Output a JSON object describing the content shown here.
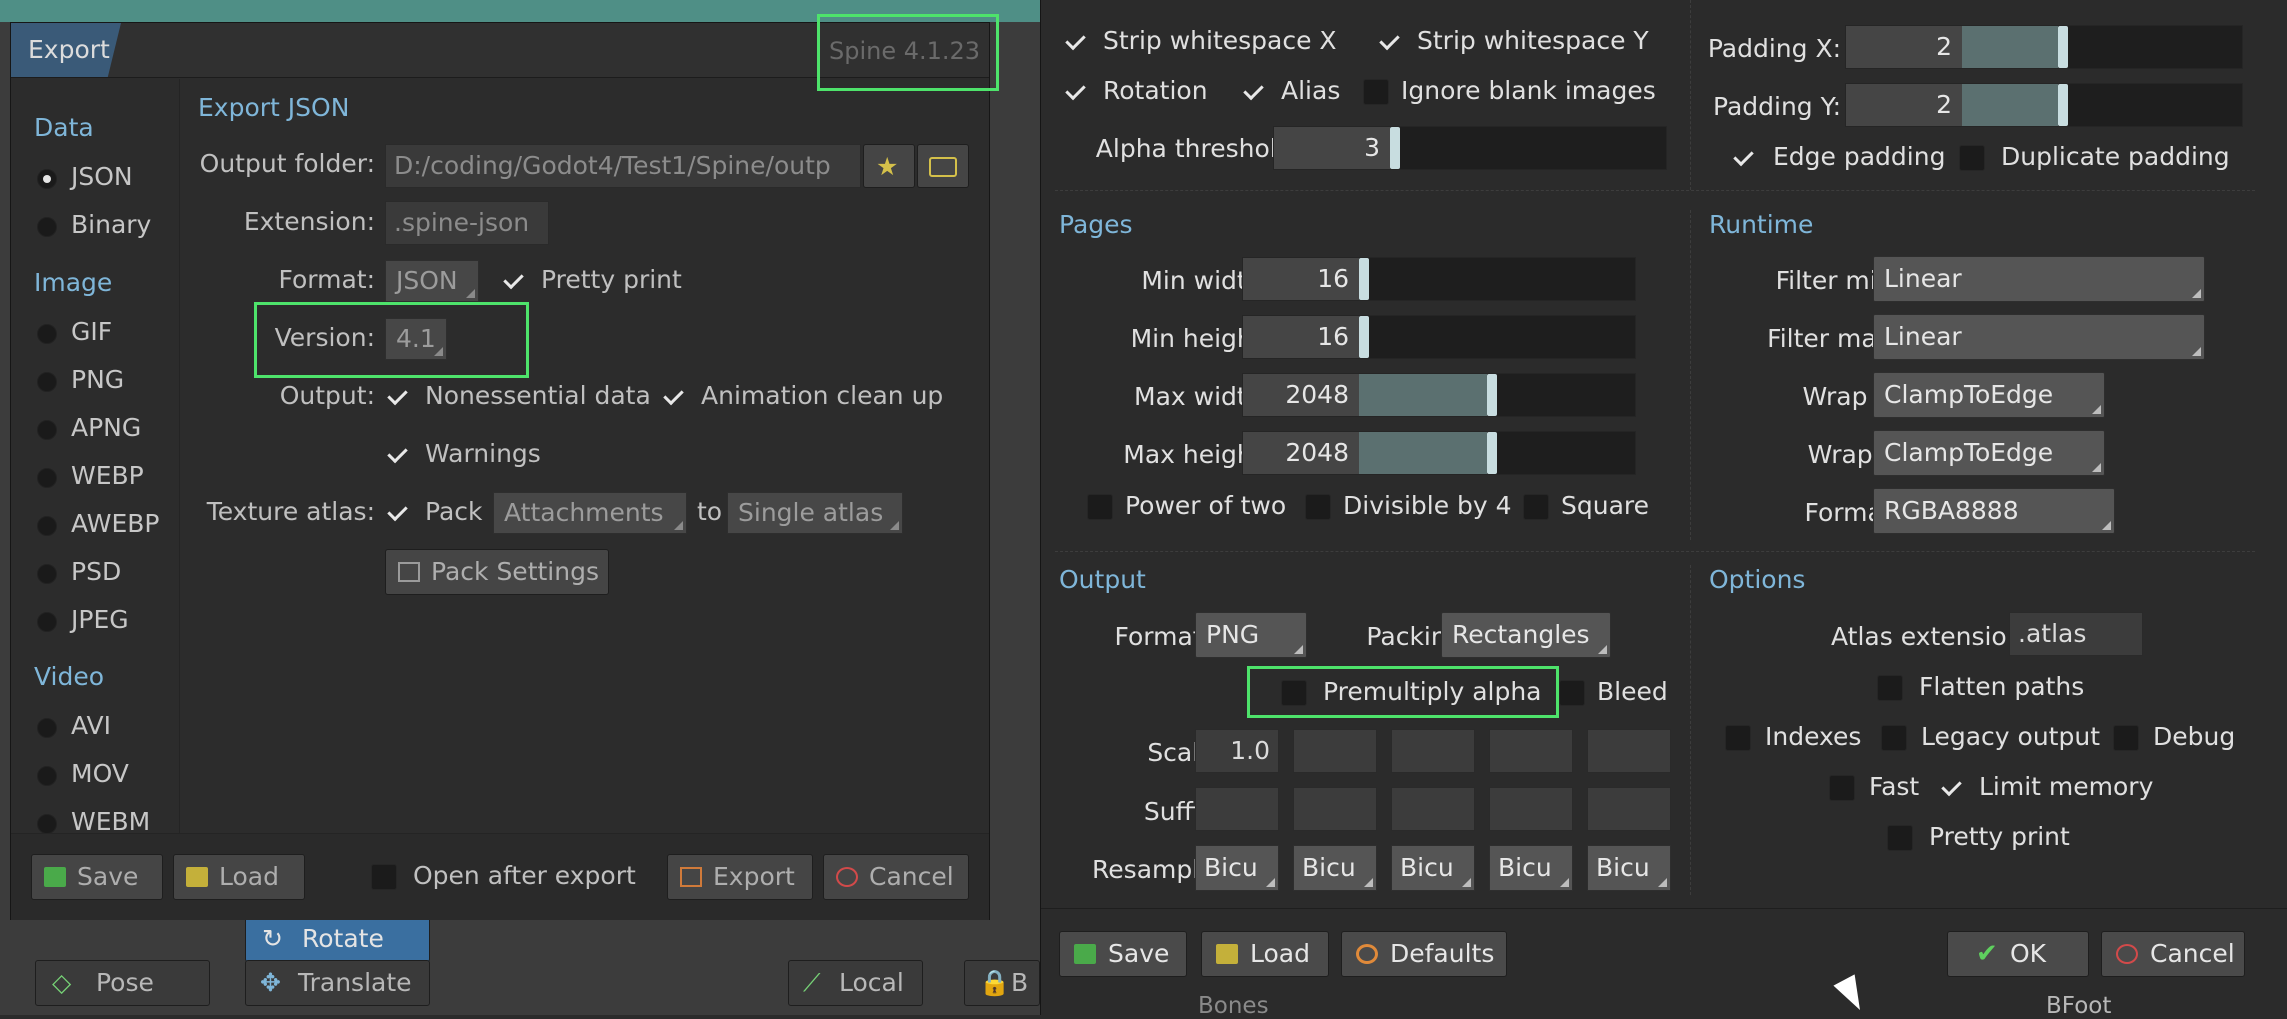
{
  "left_dialog": {
    "title": "Export",
    "version_badge": "Spine 4.1.23",
    "sidebar": {
      "categories": [
        {
          "label": "Data",
          "items": [
            {
              "label": "JSON",
              "selected": true
            },
            {
              "label": "Binary",
              "selected": false
            }
          ]
        },
        {
          "label": "Image",
          "items": [
            {
              "label": "GIF"
            },
            {
              "label": "PNG"
            },
            {
              "label": "APNG"
            },
            {
              "label": "WEBP"
            },
            {
              "label": "AWEBP"
            },
            {
              "label": "PSD"
            },
            {
              "label": "JPEG"
            }
          ]
        },
        {
          "label": "Video",
          "items": [
            {
              "label": "AVI"
            },
            {
              "label": "MOV"
            },
            {
              "label": "WEBM"
            }
          ]
        }
      ]
    },
    "section_title": "Export JSON",
    "output_folder": {
      "label": "Output folder:",
      "value": "D:/coding/Godot4/Test1/Spine/outp"
    },
    "extension": {
      "label": "Extension:",
      "value": ".spine-json"
    },
    "format": {
      "label": "Format:",
      "value": "JSON",
      "pretty_print": "Pretty print"
    },
    "version": {
      "label": "Version:",
      "value": "4.1"
    },
    "output": {
      "label": "Output:",
      "nonessential": "Nonessential data",
      "cleanup": "Animation clean up",
      "warnings": "Warnings"
    },
    "texture_atlas": {
      "label": "Texture atlas:",
      "pack": "Pack",
      "source": "Attachments",
      "to": "to",
      "target": "Single atlas",
      "settings_button": "Pack Settings"
    },
    "footer": {
      "save": "Save",
      "load": "Load",
      "open_after": "Open after export",
      "export": "Export",
      "cancel": "Cancel"
    }
  },
  "right_dialog": {
    "region": {
      "strip_x": "Strip whitespace X",
      "strip_y": "Strip whitespace Y",
      "rotation": "Rotation",
      "alias": "Alias",
      "ignore_blank": "Ignore blank images",
      "alpha_threshold": {
        "label": "Alpha threshold:",
        "value": "3"
      }
    },
    "padding": {
      "padding_x": {
        "label": "Padding X:",
        "value": "2"
      },
      "padding_y": {
        "label": "Padding Y:",
        "value": "2"
      },
      "edge_padding": "Edge padding",
      "duplicate_padding": "Duplicate padding"
    },
    "pages": {
      "title": "Pages",
      "min_width": {
        "label": "Min width:",
        "value": "16"
      },
      "min_height": {
        "label": "Min height:",
        "value": "16"
      },
      "max_width": {
        "label": "Max width:",
        "value": "2048"
      },
      "max_height": {
        "label": "Max height:",
        "value": "2048"
      },
      "power_of_two": "Power of two",
      "divisible_by_4": "Divisible by 4",
      "square": "Square"
    },
    "runtime": {
      "title": "Runtime",
      "filter_min": {
        "label": "Filter min:",
        "value": "Linear"
      },
      "filter_mag": {
        "label": "Filter mag:",
        "value": "Linear"
      },
      "wrap_x": {
        "label": "Wrap X:",
        "value": "ClampToEdge"
      },
      "wrap_y": {
        "label": "Wrap Y:",
        "value": "ClampToEdge"
      },
      "format": {
        "label": "Format:",
        "value": "RGBA8888"
      }
    },
    "output": {
      "title": "Output",
      "format_label": "Format:",
      "format_value": "PNG",
      "packing_label": "Packing:",
      "packing_value": "Rectangles",
      "premultiply": "Premultiply alpha",
      "bleed": "Bleed",
      "scale_label": "Scale:",
      "scale_value": "1.0",
      "suffix_label": "Suffix:",
      "resample_label": "Resample:",
      "resample_value": "Bicu"
    },
    "options": {
      "title": "Options",
      "atlas_ext_label": "Atlas extension:",
      "atlas_ext_value": ".atlas",
      "flatten_paths": "Flatten paths",
      "indexes": "Indexes",
      "legacy_output": "Legacy output",
      "debug": "Debug",
      "fast": "Fast",
      "limit_memory": "Limit memory",
      "pretty_print": "Pretty print"
    },
    "footer": {
      "save": "Save",
      "load": "Load",
      "defaults": "Defaults",
      "ok": "OK",
      "cancel": "Cancel"
    }
  },
  "toolbar": {
    "rotate": "Rotate",
    "pose": "Pose",
    "translate": "Translate",
    "local": "Local",
    "frag_b": "B",
    "bones": "Bones",
    "bfoot": "BFoot"
  },
  "colors": {
    "accent_blue": "#7fb6d9",
    "highlight_green": "#4ee36b"
  }
}
